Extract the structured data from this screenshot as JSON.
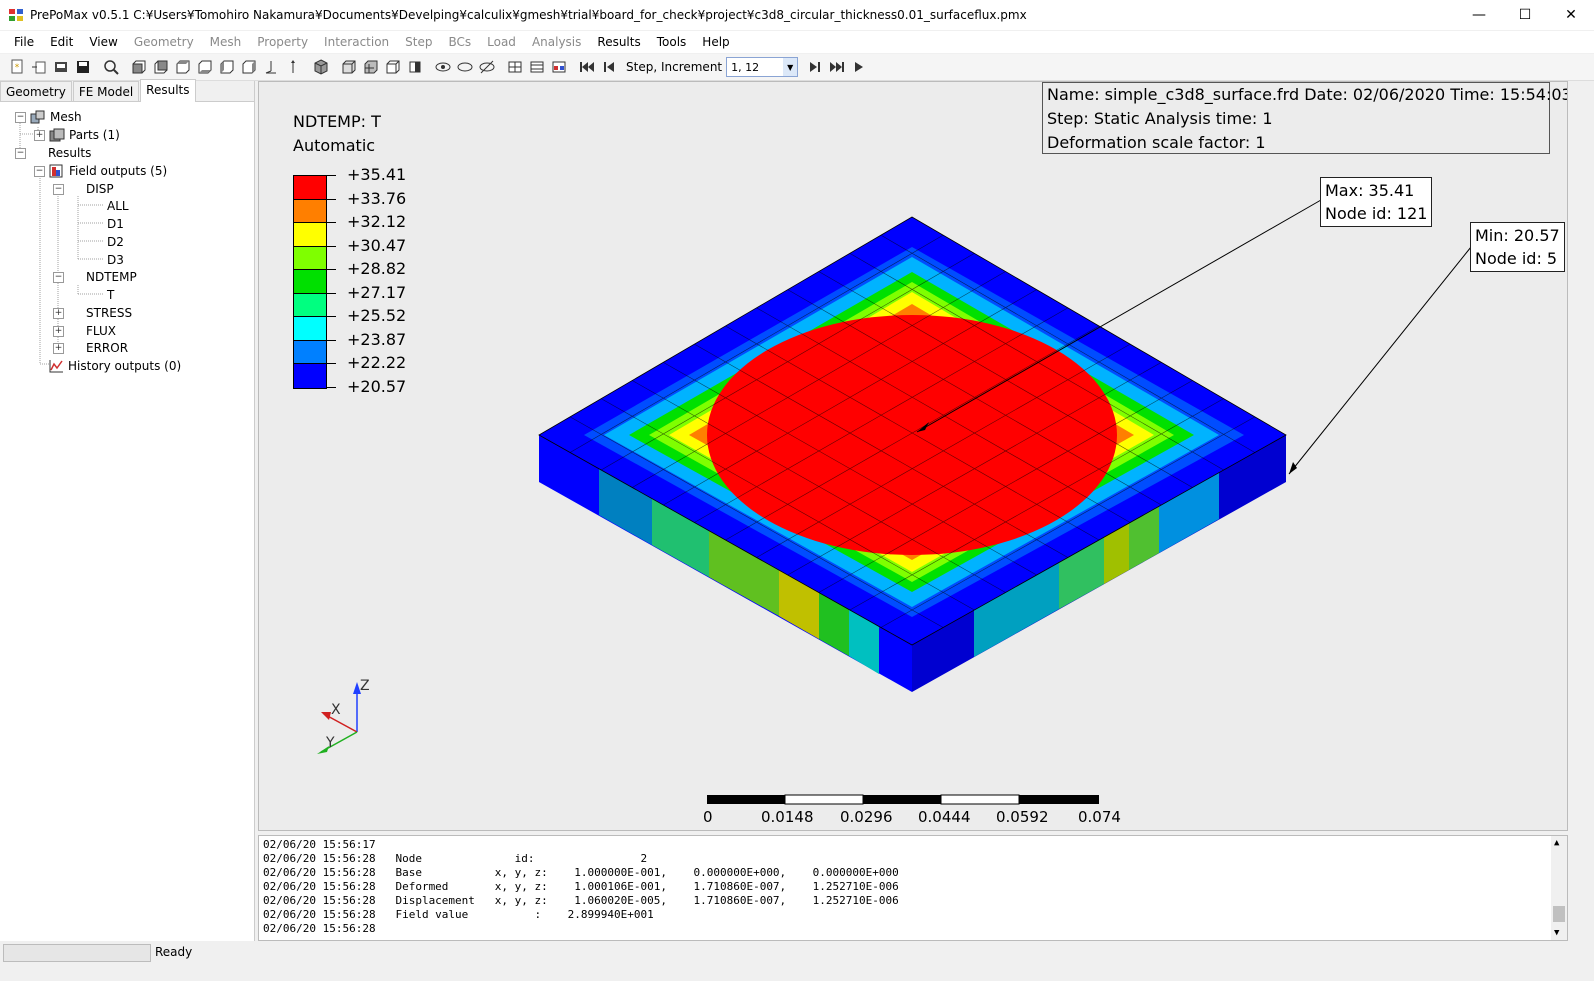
{
  "window": {
    "title": "PrePoMax v0.5.1   C:¥Users¥Tomohiro Nakamura¥Documents¥Develping¥calculix¥gmesh¥trial¥board_for_check¥project¥c3d8_circular_thickness0.01_surfaceflux.pmx",
    "minimize": "—",
    "maximize": "☐",
    "close": "✕"
  },
  "menu": [
    {
      "label": "File"
    },
    {
      "label": "Edit"
    },
    {
      "label": "View"
    },
    {
      "label": "Geometry"
    },
    {
      "label": "Mesh"
    },
    {
      "label": "Property"
    },
    {
      "label": "Interaction"
    },
    {
      "label": "Step"
    },
    {
      "label": "BCs"
    },
    {
      "label": "Load"
    },
    {
      "label": "Analysis"
    },
    {
      "label": "Results"
    },
    {
      "label": "Tools"
    },
    {
      "label": "Help"
    }
  ],
  "toolbar": {
    "step_increment_label": "Step, Increment",
    "step_increment_value": "1, 12"
  },
  "tabs": [
    {
      "label": "Geometry"
    },
    {
      "label": "FE Model"
    },
    {
      "label": "Results"
    }
  ],
  "tree": {
    "mesh": "Mesh",
    "parts": "Parts (1)",
    "results": "Results",
    "field_outputs": "Field outputs (5)",
    "disp": "DISP",
    "all": "ALL",
    "d1": "D1",
    "d2": "D2",
    "d3": "D3",
    "ndtemp": "NDTEMP",
    "t": "T",
    "stress": "STRESS",
    "flux": "FLUX",
    "error": "ERROR",
    "history_outputs": "History outputs (0)"
  },
  "legend": {
    "field": "NDTEMP: T",
    "mode": "Automatic",
    "values": [
      "+35.41",
      "+33.76",
      "+32.12",
      "+30.47",
      "+28.82",
      "+27.17",
      "+25.52",
      "+23.87",
      "+22.22",
      "+20.57"
    ],
    "colors": [
      "#ff0000",
      "#ff7f00",
      "#ffff00",
      "#7fff00",
      "#00e000",
      "#00ff80",
      "#00ffff",
      "#0080ff",
      "#0000ff"
    ]
  },
  "info": {
    "line1": "Name: simple_c3d8_surface.frd    Date: 02/06/2020    Time: 15:54:03",
    "line2": "Step: Static    Analysis time: 1",
    "line3": "Deformation scale factor: 1"
  },
  "max_callout": {
    "value": "Max: 35.41",
    "node": "Node id: 121"
  },
  "min_callout": {
    "value": "Min: 20.57",
    "node": "Node id: 5"
  },
  "triad": {
    "z": "Z",
    "x": "X",
    "y": "Y"
  },
  "scale_bar": {
    "labels": [
      "0",
      "0.0148",
      "0.0296",
      "0.0444",
      "0.0592",
      "0.074"
    ]
  },
  "console": {
    "lines": [
      "02/06/20 15:56:17",
      "02/06/20 15:56:28   Node              id:                2",
      "02/06/20 15:56:28   Base           x, y, z:    1.000000E-001,    0.000000E+000,    0.000000E+000",
      "02/06/20 15:56:28   Deformed       x, y, z:    1.000106E-001,    1.710860E-007,    1.252710E-006",
      "02/06/20 15:56:28   Displacement   x, y, z:    1.060020E-005,    1.710860E-007,    1.252710E-006",
      "02/06/20 15:56:28   Field value          :    2.899940E+001",
      "02/06/20 15:56:28"
    ]
  },
  "status": {
    "text": "Ready"
  }
}
